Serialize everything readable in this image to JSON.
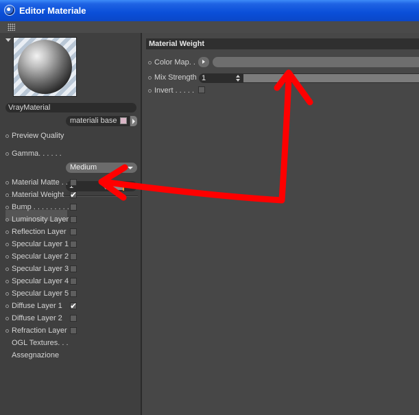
{
  "window": {
    "title": "Editor Materiale",
    "app_icon": "cinema4d-icon"
  },
  "left": {
    "material_name": "VrayMaterial",
    "layer": {
      "value": "materiali base",
      "swatch_color": "#d9b6c6"
    },
    "preview_quality": {
      "label": "Preview Quality",
      "value": "Medium"
    },
    "gamma": {
      "label": "Gamma. . . . . .",
      "value": "1",
      "slider_level": 0.45,
      "knob_color": "#f0a020"
    },
    "channels": [
      {
        "label": "Material Matte . .",
        "checked": false,
        "dot": true
      },
      {
        "label": "Material Weight",
        "checked": true,
        "dot": true,
        "selected": true
      },
      {
        "label": "Bump . . . . . . . . .",
        "checked": false,
        "dot": true
      },
      {
        "label": "Luminosity Layer",
        "checked": false,
        "dot": true
      },
      {
        "label": "Reflection Layer",
        "checked": false,
        "dot": true
      },
      {
        "label": "Specular Layer 1",
        "checked": false,
        "dot": true
      },
      {
        "label": "Specular Layer 2",
        "checked": false,
        "dot": true
      },
      {
        "label": "Specular Layer 3",
        "checked": false,
        "dot": true
      },
      {
        "label": "Specular Layer 4",
        "checked": false,
        "dot": true
      },
      {
        "label": "Specular Layer 5",
        "checked": false,
        "dot": true
      },
      {
        "label": "Diffuse Layer 1",
        "checked": true,
        "dot": true
      },
      {
        "label": "Diffuse Layer 2",
        "checked": false,
        "dot": true
      },
      {
        "label": "Refraction Layer",
        "checked": false,
        "dot": true
      },
      {
        "label": "OGL Textures. . .",
        "checked": null,
        "dot": false
      },
      {
        "label": "Assegnazione",
        "checked": null,
        "dot": false
      }
    ]
  },
  "right": {
    "section_title": "Material Weight",
    "color_map": {
      "label": "Color Map. ."
    },
    "mix_strength": {
      "label": "Mix Strength",
      "value": "1",
      "slider_level": 1.0
    },
    "invert": {
      "label": "Invert . . . . .",
      "checked": false
    }
  },
  "annotation": {
    "color": "#ff0000",
    "shape": "red-double-headed-arrow"
  }
}
